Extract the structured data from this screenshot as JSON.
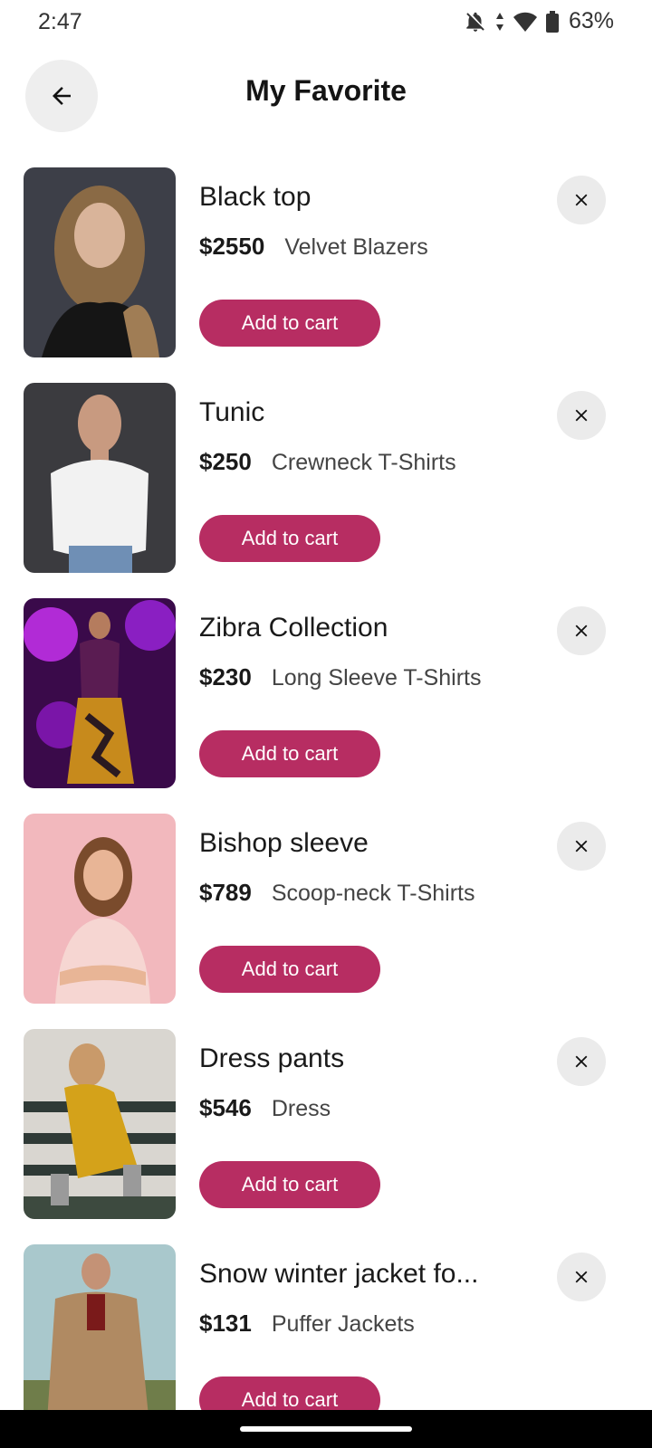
{
  "status_bar": {
    "time": "2:47",
    "battery": "63%"
  },
  "header": {
    "title": "My Favorite"
  },
  "icons": {
    "back": "arrow-left-icon",
    "remove": "close-icon"
  },
  "colors": {
    "accent": "#b72d62",
    "button_bg": "#ebebeb"
  },
  "favorites": [
    {
      "name": "Black top",
      "price": "$2550",
      "category": "Velvet Blazers",
      "cart_label": "Add to cart"
    },
    {
      "name": "Tunic",
      "price": "$250",
      "category": "Crewneck T-Shirts",
      "cart_label": "Add to cart"
    },
    {
      "name": "Zibra Collection",
      "price": "$230",
      "category": "Long Sleeve T-Shirts",
      "cart_label": "Add to cart"
    },
    {
      "name": "Bishop sleeve",
      "price": "$789",
      "category": "Scoop-neck T-Shirts",
      "cart_label": "Add to cart"
    },
    {
      "name": "Dress pants",
      "price": "$546",
      "category": "Dress",
      "cart_label": "Add to cart"
    },
    {
      "name": "Snow winter jacket fo...",
      "price": "$131",
      "category": "Puffer Jackets",
      "cart_label": "Add to cart"
    }
  ]
}
